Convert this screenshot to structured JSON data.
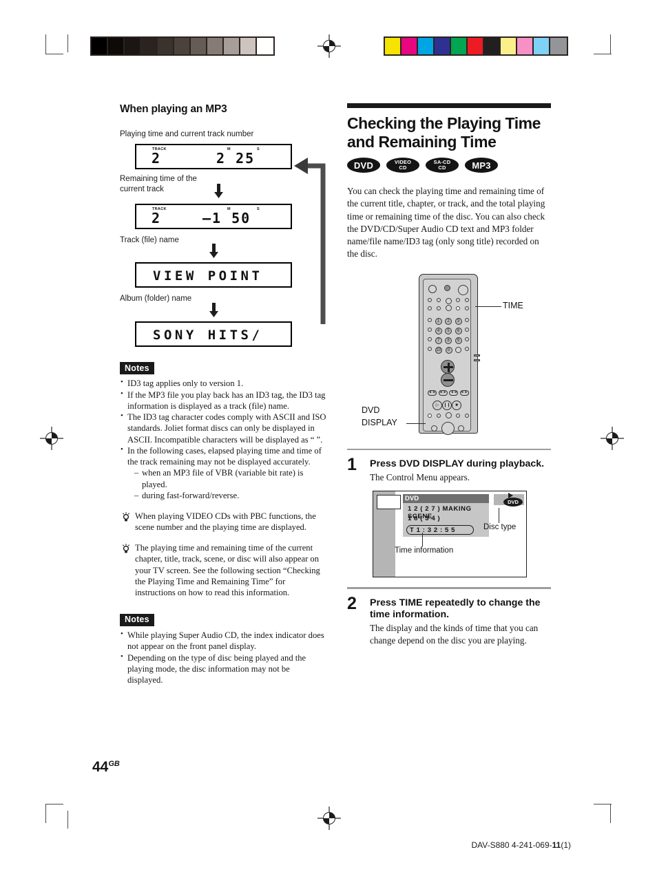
{
  "prepress": {
    "gray_swatches": [
      "#000000",
      "#0d0a08",
      "#1b1613",
      "#2a231f",
      "#3a322d",
      "#4b423c",
      "#665c56",
      "#867b75",
      "#a89e99",
      "#cdc4c0",
      "#ffffff"
    ],
    "color_swatches": [
      "#f5e400",
      "#e8077f",
      "#00a5e3",
      "#2e3192",
      "#00a651",
      "#ed1c24",
      "#231f20",
      "#fbef8a",
      "#f791c5",
      "#7ed2f5",
      "#939598"
    ]
  },
  "left": {
    "section_heading": "When playing an MP3",
    "caption_time_track": "Playing time and current track number",
    "caption_remaining": "Remaining time of the\ncurrent track",
    "caption_track_name": "Track (file) name",
    "caption_album_name": "Album (folder) name",
    "display_1": {
      "track_label": "TRACK",
      "track_value": "2",
      "m_label": "M",
      "s_label": "S",
      "time_value": "2 25"
    },
    "display_2": {
      "track_label": "TRACK",
      "track_value": "2",
      "m_label": "M",
      "s_label": "S",
      "time_value": "–1 50"
    },
    "display_3": {
      "text": "VIEW POINT"
    },
    "display_4": {
      "text": "SONY HITS/"
    },
    "notes_label_1": "Notes",
    "notes_1": [
      "ID3 tag applies only to version 1.",
      "If the MP3 file you play back has an ID3 tag, the ID3 tag information is displayed as a track (file) name.",
      "The ID3 tag character codes comply with ASCII and ISO standards. Joliet format discs can only be displayed in ASCII. Incompatible characters will be displayed as “ ”.",
      "In the following cases, elapsed playing time and time of the track remaining may not be displayed accurately."
    ],
    "notes_1_sub": [
      "when an MP3 file of VBR (variable bit rate) is played.",
      "during fast-forward/reverse."
    ],
    "tip_1": "When playing VIDEO CDs with PBC functions, the scene number and the playing time are displayed.",
    "tip_2": "The playing time and remaining time of the current chapter, title, track, scene, or disc will also appear on your TV screen. See the following section “Checking the Playing Time and Remaining Time” for instructions on how to read this information.",
    "notes_label_2": "Notes",
    "notes_2": [
      "While playing Super Audio CD, the index indicator does not appear on the front panel display.",
      "Depending on the type of disc being played and the playing mode, the disc information may not be displayed."
    ]
  },
  "right": {
    "title": "Checking the Playing Time and Remaining Time",
    "badges": [
      {
        "line1": "DVD",
        "line2": ""
      },
      {
        "line1": "VIDEO",
        "line2": "CD"
      },
      {
        "line1": "SA-CD",
        "line2": "CD"
      },
      {
        "line1": "MP3",
        "line2": ""
      }
    ],
    "intro": "You can check the playing time and remaining time of the current title, chapter, or track, and the total playing time or remaining time of the disc. You can also check the DVD/CD/Super Audio CD text and MP3 folder name/file name/ID3 tag (only song title) recorded on the disc.",
    "remote": {
      "callout_time": "TIME",
      "callout_dvd_display_line1": "DVD",
      "callout_dvd_display_line2": "DISPLAY",
      "number_keys": [
        "1",
        "2",
        "3",
        "4",
        "5",
        "6",
        "7",
        "8",
        "9",
        "10",
        "0"
      ]
    },
    "steps": [
      {
        "number": "1",
        "heading": "Press DVD DISPLAY during playback.",
        "text": "The Control Menu appears."
      },
      {
        "number": "2",
        "heading": "Press TIME repeatedly to change the time information.",
        "text": "The display and the kinds of time that you can change depend on the disc you are playing."
      }
    ],
    "control_menu": {
      "header": "DVD",
      "line1": "1 2 ( 2 7 ) MAKING SCENE",
      "line2": "1 8 ( 3 4 )",
      "time": "T   1 : 3 2 : 5 5",
      "disc_badge": "DVD",
      "label_time_info": "Time information",
      "label_disc_type": "Disc type"
    }
  },
  "footer": {
    "page_number": "44",
    "page_suffix": "GB",
    "code_prefix": "DAV-S880 4-241-069-",
    "code_bold": "11",
    "code_suffix": "(1)"
  }
}
